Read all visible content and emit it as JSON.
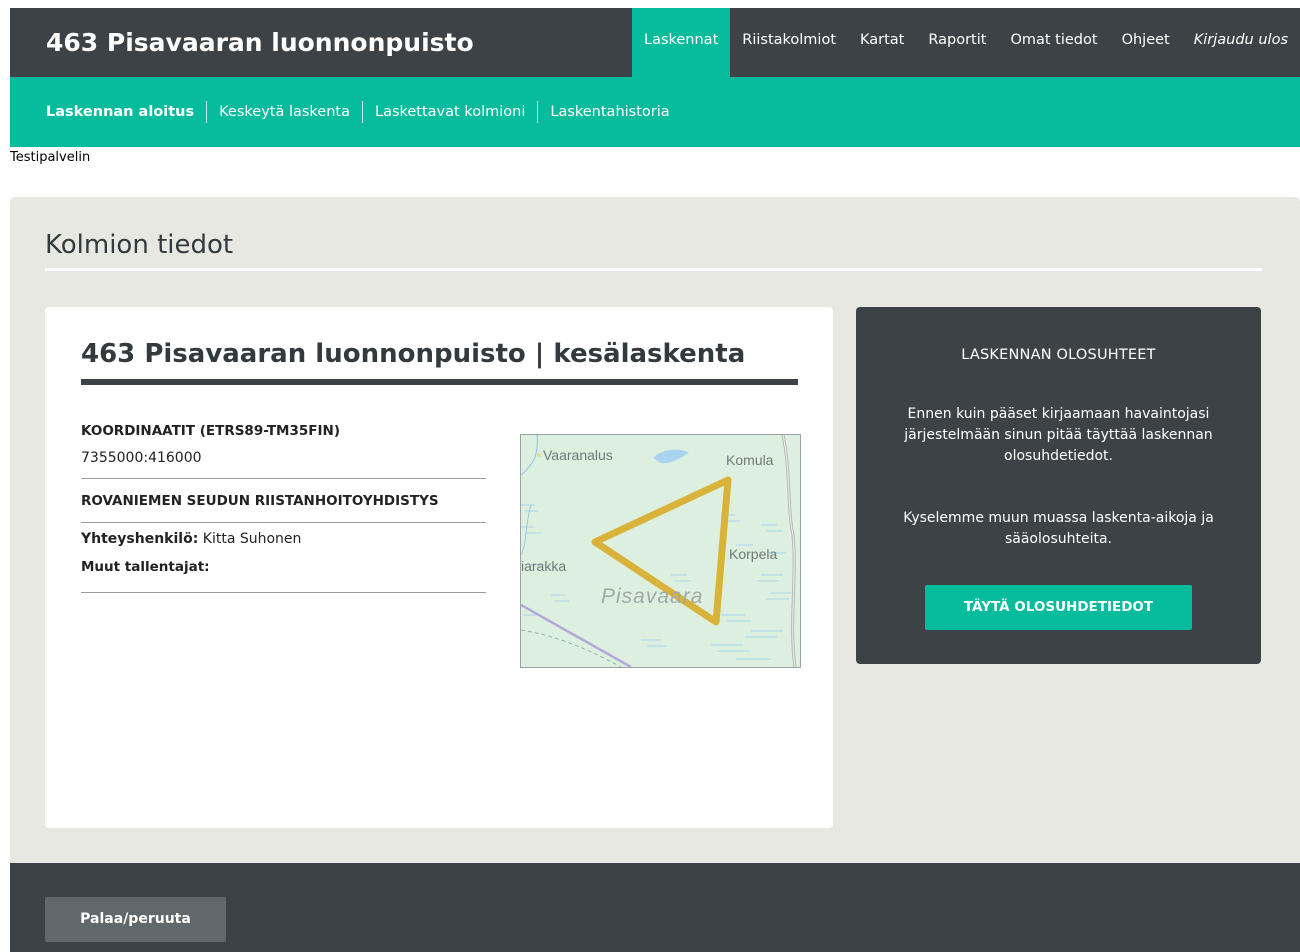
{
  "header": {
    "site_title": "463 Pisavaaran luonnonpuisto",
    "nav": [
      {
        "label": "Laskennat",
        "active": true
      },
      {
        "label": "Riistakolmiot"
      },
      {
        "label": "Kartat"
      },
      {
        "label": "Raportit"
      },
      {
        "label": "Omat tiedot"
      },
      {
        "label": "Ohjeet"
      },
      {
        "label": "Kirjaudu ulos"
      }
    ]
  },
  "subnav": [
    {
      "label": "Laskennan aloitus",
      "active": true
    },
    {
      "label": "Keskeytä laskenta"
    },
    {
      "label": "Laskettavat kolmioni"
    },
    {
      "label": "Laskentahistoria"
    }
  ],
  "environment_label": "Testipalvelin",
  "section_title": "Kolmion tiedot",
  "card": {
    "title": "463 Pisavaaran luonnonpuisto | kesälaskenta",
    "coord_heading": "KOORDINAATIT (ETRS89-TM35FIN)",
    "coord_value": "7355000:416000",
    "rhy_heading": "ROVANIEMEN SEUDUN RIISTANHOITOYHDISTYS",
    "contact_label": "Yhteyshenkilö:",
    "contact_value": "Kitta Suhonen",
    "others_label": "Muut tallentajat:"
  },
  "map": {
    "labels": {
      "vaaranalus": "Vaaranalus",
      "komula": "Komula",
      "korpela": "Korpela",
      "harakka": "iarakka",
      "pisavaara": "Pisavaara"
    },
    "colors": {
      "land": "#ddf0df",
      "triangle": "#d9b23a",
      "water": "#a9d3ef",
      "road": "#b3a8d8"
    }
  },
  "conditions": {
    "title": "LASKENNAN OLOSUHTEET",
    "text1": "Ennen kuin pääset kirjaamaan havaintojasi järjestelmään sinun pitää täyttää laskennan olosuhdetiedot.",
    "text2": "Kyselemme muun muassa laskenta-aikoja ja sääolosuhteita.",
    "button_label": "TÄYTÄ OLOSUHDETIEDOT"
  },
  "footer": {
    "back_label": "Palaa/peruuta"
  },
  "colors": {
    "accent": "#07bc9d",
    "dark": "#3c4245",
    "panel_bg": "#e8e8e3"
  }
}
